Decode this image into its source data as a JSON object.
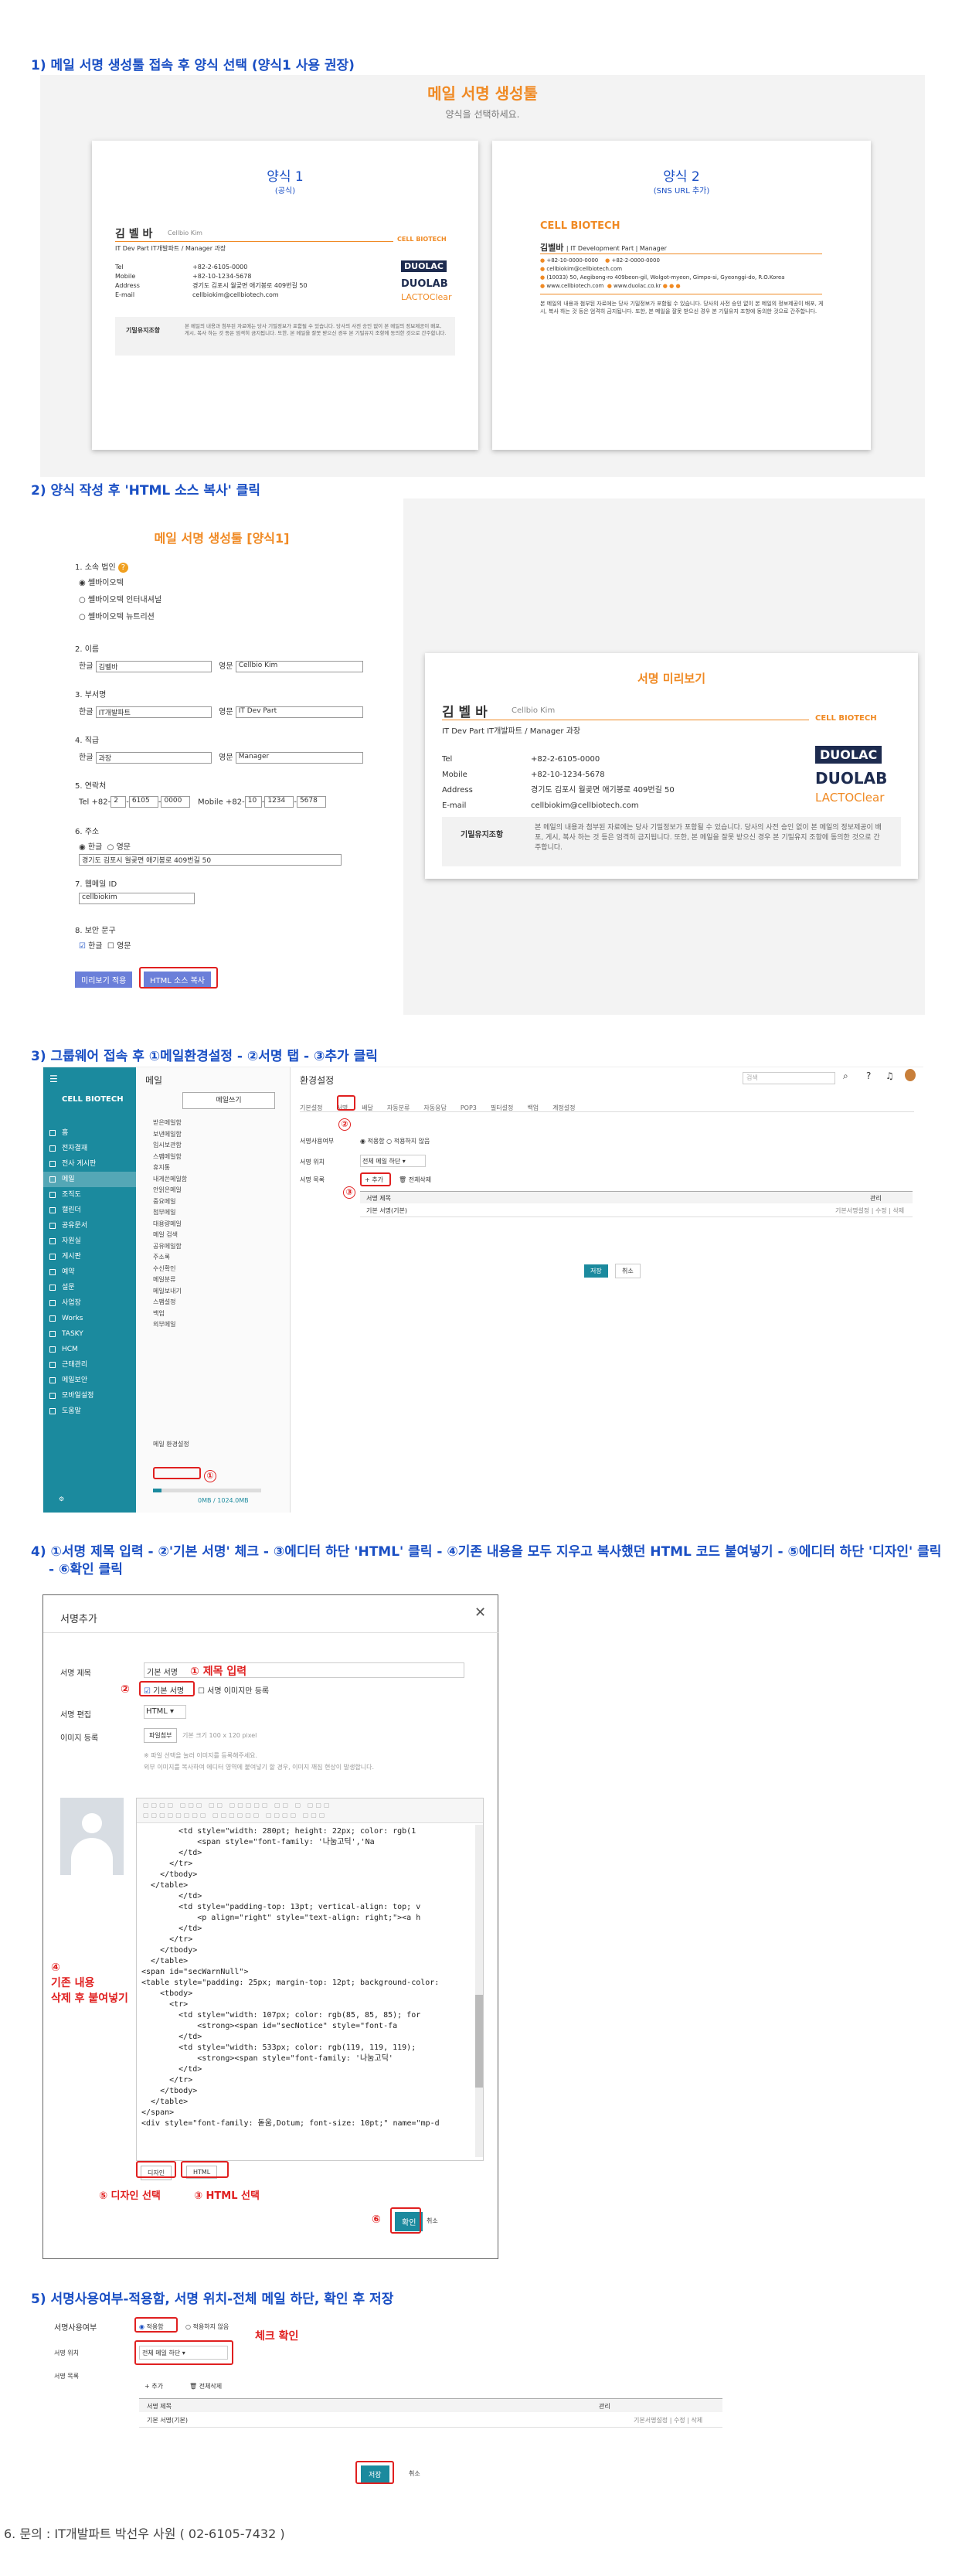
{
  "steps": {
    "s1": "1) 메일 서명 생성툴 접속 후 양식 선택 (양식1 사용 권장)",
    "s2": "2) 양식 작성 후 'HTML 소스 복사' 클릭",
    "s3": "3) 그룹웨어 접속 후  ①메일환경설정 - ②서명 탭 - ③추가 클릭",
    "s4a": "4) ①서명 제목 입력 - ②'기본 서명' 체크 - ③에디터 하단 'HTML' 클릭 - ④기존 내용을 모두 지우고 복사했던 HTML 코드 붙여넣기 - ⑤에디터 하단 '디자인' 클릭",
    "s4b": "- ⑥확인 클릭",
    "s5": "5) 서명사용여부-적용함, 서명 위치-전체 메일 하단, 확인 후 저장",
    "s6": "6. 문의 : IT개발파트 박선우 사원 ( 02-6105-7432 )"
  },
  "gen": {
    "title": "메일 서명 생성툴",
    "subtitle": "양식을 선택하세요.",
    "form1_title": "양식 1",
    "form1_sub": "(공식)",
    "form2_title": "양식 2",
    "form2_sub": "(SNS URL 추가)"
  },
  "sig": {
    "name": "김 벨 바",
    "name_en": "Cellbio Kim",
    "dept": "IT Dev Part IT개발파트 / Manager 과장",
    "tel_label": "Tel",
    "tel": "+82-2-6105-0000",
    "mobile_label": "Mobile",
    "mobile": "+82-10-1234-5678",
    "address_label": "Address",
    "address": "경기도 김포시 월곶면 애기봉로 409번길 50",
    "email_label": "E-mail",
    "email": "cellbiokim@cellbiotech.com",
    "brand": "CELL BIOTECH",
    "duolac": "DUOLAC",
    "duolab": "DUOLAB",
    "lacto": "LACTOClear",
    "confid_label": "기밀유지조항",
    "confid": "본 메일의 내용과 첨부된 자료에는 당사 기밀정보가 포함될 수 있습니다. 당사의 사전 승인 없이 본 메일의 정보제공이 배포, 게시, 복사 하는 것 등은 엄격히 금지됩니다. 또한, 본 메일을 잘못 받으신 경우 본 기밀유지 조항에 동의한 것으로 간주합니다."
  },
  "sig2": {
    "name": "김벨바",
    "dept": "| IT Development Part | Manager",
    "phone": "+82-10-0000-0000",
    "tel": "+82-2-0000-0000",
    "email": "cellbiokim@cellbiotech.com",
    "addr": "(10033) 50, Aegibong-ro 409beon-gil, Wolgot-myeon, Gimpo-si, Gyeonggi-do, R.O.Korea",
    "web1": "www.cellbiotech.com",
    "web2": "www.duolac.co.kr",
    "conf": "본 메일의 내용과 첨부된 자료에는 당사 기밀정보가 포함될 수 있습니다. 당사의 사전 승인 없이 본 메일의 정보제공이 배포, 게시, 복사 하는 것 등은 엄격히 금지됩니다. 또한, 본 메일을 잘못 받으신 경우 본 기밀유지 조항에 동의한 것으로 간주합니다."
  },
  "form": {
    "title": "메일 서명 생성툴 [양식1]",
    "q1": "1. 소속 법인",
    "r1": "쎌바이오텍",
    "r2": "쎌바이오텍 인터내셔널",
    "r3": "쎌바이오텍 뉴트리션",
    "q2": "2. 이름",
    "q3": "3. 부서명",
    "q4": "4. 직급",
    "q5": "5. 연락처",
    "q6": "6. 주소",
    "q7": "7. 웹메일 ID",
    "q8": "8. 보안 문구",
    "kor": "한글",
    "eng": "영문",
    "name_ko": "김벨바",
    "name_en": "Cellbio Kim",
    "dept_ko": "IT개발파트",
    "dept_en": "IT Dev Part",
    "rank_ko": "과장",
    "rank_en": "Manager",
    "tel_l": "Tel",
    "tel_cc": "+82-",
    "tel1": "2",
    "tel2": "6105",
    "tel3": "0000",
    "mob_l": "Mobile",
    "mob_cc": "+82-",
    "mob1": "10",
    "mob2": "1234",
    "mob3": "5678",
    "addr_ko": "한글",
    "addr_en": "영문",
    "addr": "경기도 김포시 월곶면 애기봉로 409번길 50",
    "id": "cellbiokim",
    "sec_ko": "한글",
    "sec_en": "영문",
    "btn_preview": "미리보기 적용",
    "btn_copy": "HTML 소스 복사",
    "preview_title": "서명 미리보기"
  },
  "gw": {
    "mail": "메일",
    "write": "메일쓰기",
    "settings": "환경설정",
    "search_ph": "검색",
    "tabs": [
      "기본설정",
      "서명",
      "배달",
      "자동분류",
      "자동응답",
      "POP3",
      "필터설정",
      "백업",
      "계정설정"
    ],
    "use_label": "서명사용여부",
    "use_opt1": "적용함",
    "use_opt2": "적용하지 않음",
    "pos_label": "서명 위치",
    "pos_value": "전체 메일 하단",
    "list_label": "서명 목록",
    "add": "추가",
    "del": "전체삭제",
    "col_title": "서명 제목",
    "col_manage": "관리",
    "row1": "기본 서명(기본)",
    "row1_actions": "기본서명설정 | 수정 | 삭제",
    "save": "저장",
    "cancel": "취소",
    "sidebar": [
      "홈",
      "전자결재",
      "전사 게시판",
      "메일",
      "조직도",
      "캘린더",
      "공유문서",
      "자원실",
      "게시판",
      "예약",
      "설문",
      "사업장",
      "Works",
      "TASKY",
      "HCM",
      "근태관리",
      "메일보안",
      "모바일설정",
      "도움말"
    ],
    "mailtree": [
      "받은메일함",
      "보낸메일함",
      "임시보관함",
      "스팸메일함",
      "휴지통",
      "내게쓴메일함",
      "안읽은메일",
      "중요메일",
      "첨부메일",
      "대용량메일",
      "메일 검색",
      "공유메일함",
      "주소록",
      "수신확인",
      "메일분류",
      "메일보내기",
      "스팸설정",
      "백업",
      "외부메일",
      "메일 환경설정"
    ],
    "quota": "0MB / 1024.0MB",
    "marker1": "①",
    "marker2": "②",
    "marker3": "③"
  },
  "dialog": {
    "title": "서명추가",
    "f_title": "서명 제목",
    "f_title_val": "기본 서명",
    "f_default": "기본 서명",
    "f_imgonly": "서명 이미지만 등록",
    "f_edit": "서명 편집",
    "f_edit_val": "HTML",
    "f_img": "이미지 등록",
    "f_img_btn": "파일첨부",
    "f_img_hint": "기본 크기 100 x 120 pixel",
    "hint1": "※ 파일 선택을 눌러 이미지를 등록해주세요.",
    "hint2": "외부 이미지를 복사하여 에디터 영역에 붙여넣기 할 경우, 이미지 깨짐 현상이 발생합니다.",
    "design_btn": "디자인",
    "html_btn": "HTML",
    "ok": "확인",
    "cancel": "취소",
    "ann1": "① 제목 입력",
    "ann2": "②",
    "ann3": "③ HTML 선택",
    "ann4a": "④",
    "ann4b": "기존 내용",
    "ann4c": "삭제 후 붙여넣기",
    "ann5": "⑤ 디자인 선택",
    "ann6": "⑥",
    "code": "        <td style=\"width: 280pt; height: 22px; color: rgb(1\n            <span style=\"font-family: '나눔고딕','Na\n        </td>\n      </tr>\n    </tbody>\n  </table>\n        </td>\n        <td style=\"padding-top: 13pt; vertical-align: top; v\n            <p align=\"right\" style=\"text-align: right;\"><a h\n        </td>\n      </tr>\n    </tbody>\n  </table>\n<span id=\"secWarnNull\">\n<table style=\"padding: 25px; margin-top: 12pt; background-color:\n    <tbody>\n      <tr>\n        <td style=\"width: 107px; color: rgb(85, 85, 85); for\n            <strong><span id=\"secNotice\" style=\"font-fa\n        </td>\n        <td style=\"width: 533px; color: rgb(119, 119, 119);\n            <strong><span style=\"font-family: '나눔고딕'\n        </td>\n      </tr>\n    </tbody>\n  </table>\n</span>\n<div style=\"font-family: 돋움,Dotum; font-size: 10pt;\" name=\"mp-d"
  },
  "s5": {
    "use_label": "서명사용여부",
    "use1": "적용함",
    "use2": "적용하지 않음",
    "pos_label": "서명 위치",
    "pos_val": "전체 메일 하단",
    "check": "체크 확인",
    "list_label": "서명 목록",
    "add": "추가",
    "del": "전체삭제",
    "col_title": "서명 제목",
    "col_manage": "관리",
    "row1": "기본 서명(기본)",
    "row1_actions": "기본서명설정 | 수정 | 삭제",
    "save": "저장",
    "cancel": "취소"
  },
  "colors": {
    "step": "#1a4fc4",
    "orange": "#f08a24",
    "red": "#e02020",
    "teal": "#1b8a9e",
    "navy": "#1d2b4f"
  }
}
